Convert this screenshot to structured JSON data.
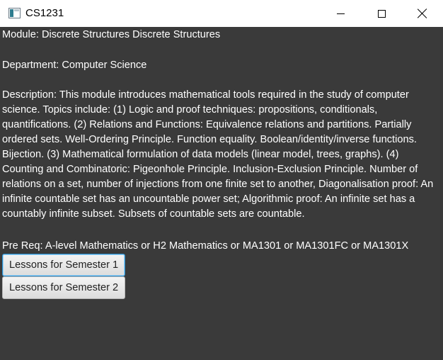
{
  "window": {
    "title": "CS1231"
  },
  "icons": {
    "app": "app-window-icon",
    "minimize": "minimize-icon",
    "maximize": "maximize-icon",
    "close": "close-icon"
  },
  "module": {
    "module_line": "Module: Discrete Structures  Discrete Structures",
    "department_line": "Department: Computer Science",
    "description_line": "Description: This module introduces mathematical tools required in the study of computer science. Topics include: (1) Logic and proof techniques: propositions, conditionals, quantifications.  (2) Relations and Functions: Equivalence relations and partitions.  Partially ordered sets.  Well-Ordering Principle. Function equality.  Boolean/identity/inverse functions. Bijection. (3) Mathematical formulation of data models (linear model, trees, graphs). (4) Counting and Combinatoric: Pigeonhole Principle. Inclusion-Exclusion Principle.  Number of relations on a set, number of injections from one finite set to another, Diagonalisation proof: An infinite countable set has an uncountable power set; Algorithmic proof: An infinite set has a countably infinite subset.  Subsets of countable sets are countable.",
    "prereq_line": "Pre Req: A-level Mathematics or H2 Mathematics or MA1301 or MA1301FC or MA1301X"
  },
  "buttons": {
    "semester1": "Lessons for Semester 1",
    "semester2": "Lessons for Semester 2"
  },
  "colors": {
    "background": "#3a3a3a",
    "text": "#ffffff",
    "focus_ring": "#2a8fd0"
  }
}
